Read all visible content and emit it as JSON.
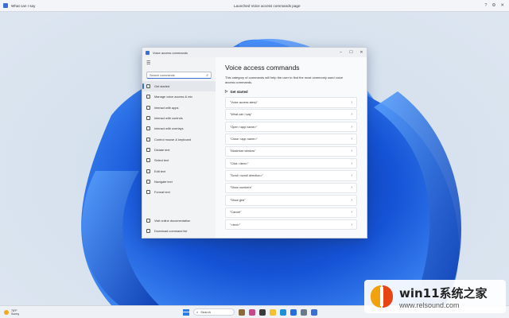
{
  "voice_bar": {
    "left_text": "What can I say",
    "center_text": "Launched Voice access commands page"
  },
  "window": {
    "title": "Voice access commands",
    "search_placeholder": "Search commands",
    "nav": [
      {
        "label": "Get started",
        "active": true
      },
      {
        "label": "Manage voice access & mic"
      },
      {
        "label": "Interact with apps"
      },
      {
        "label": "Interact with controls"
      },
      {
        "label": "Interact with overlays"
      },
      {
        "label": "Control mouse & keyboard"
      },
      {
        "label": "Dictate text"
      },
      {
        "label": "Select text"
      },
      {
        "label": "Edit text"
      },
      {
        "label": "Navigate text"
      },
      {
        "label": "Format text"
      }
    ],
    "bottom_links": [
      {
        "label": "Visit online documentation"
      },
      {
        "label": "Download command list"
      }
    ],
    "heading": "Voice access commands",
    "description": "This category of commands will help the user to find the most commonly used voice access commands.",
    "section_title": "Get started",
    "commands": [
      "\"Voice access sleep\"",
      "\"What can I say\"",
      "\"Open <app name>\"",
      "\"Close <app name>\"",
      "\"Maximize window\"",
      "\"Click <item>\"",
      "\"Scroll <scroll direction>\"",
      "\"Show numbers\"",
      "\"Show grid\"",
      "\"Cancel\"",
      "\"<text>\""
    ]
  },
  "taskbar": {
    "temperature": "78°F",
    "condition": "Sunny",
    "search_label": "Search"
  },
  "watermark": {
    "brand": "win11系统之家",
    "url": "www.relsound.com"
  }
}
